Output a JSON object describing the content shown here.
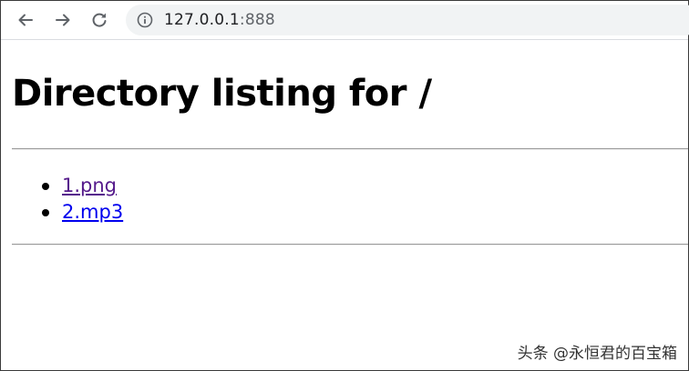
{
  "browser": {
    "url_host": "127.0.0.1",
    "url_port": ":888",
    "back_icon": "back-arrow-icon",
    "forward_icon": "forward-arrow-icon",
    "reload_icon": "reload-icon",
    "info_icon": "info-icon"
  },
  "page": {
    "heading": "Directory listing for /",
    "files": [
      {
        "name": "1.png",
        "visited": true
      },
      {
        "name": "2.mp3",
        "visited": false
      }
    ]
  },
  "colors": {
    "visited_link": "#551a8b",
    "unvisited_link": "#0000ee"
  },
  "watermark": {
    "text": "头条 @永恒君的百宝箱"
  }
}
